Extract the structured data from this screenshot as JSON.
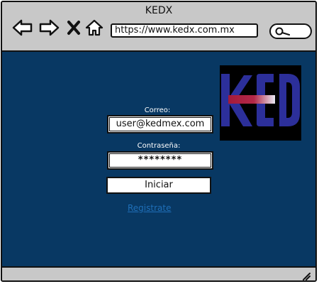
{
  "window": {
    "title": "KEDX"
  },
  "browser": {
    "url": "https://www.kedx.com.mx",
    "search_icon": "search-icon",
    "nav_icons": [
      "back-arrow-icon",
      "forward-arrow-icon",
      "close-icon",
      "home-icon"
    ]
  },
  "login": {
    "email_label": "Correo:",
    "email_value": "user@kedmex.com",
    "password_label": "Contraseña:",
    "password_value": "********",
    "submit_label": "Iniciar",
    "register_link": "Registrate"
  },
  "logo": {
    "text": "KED",
    "colors": {
      "letters": "#2c2f9a",
      "stripe": "#a31a3a",
      "background": "#000000"
    }
  },
  "colors": {
    "content_bg": "#083863",
    "chrome_bg": "#c8c8c8",
    "link": "#1f6fb8"
  }
}
